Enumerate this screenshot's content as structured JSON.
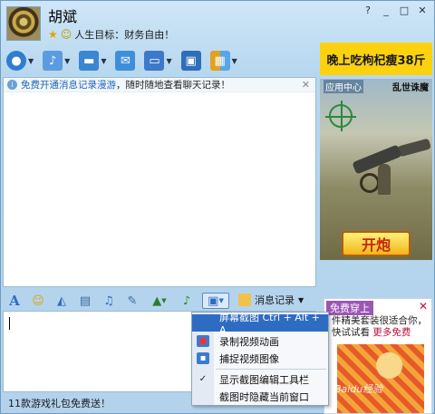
{
  "window": {
    "contact_name": "胡斌",
    "signature": "人生目标：财务自由！",
    "controls": [
      "help-icon",
      "minimize-icon",
      "maximize-icon",
      "close-icon"
    ]
  },
  "toolbar": {
    "buttons": [
      {
        "name": "video-call",
        "icon": "camera-icon",
        "color": "#2e7dd0"
      },
      {
        "name": "voice-call",
        "icon": "microphone-icon",
        "color": "#5c9be0"
      },
      {
        "name": "send-file",
        "icon": "folder-icon",
        "color": "#3a86d0"
      },
      {
        "name": "send-sms",
        "icon": "message-icon",
        "color": "#3f8fd8"
      },
      {
        "name": "remote-assist",
        "icon": "monitor-icon",
        "color": "#3c79c8"
      },
      {
        "name": "share-screen",
        "icon": "screen-icon",
        "color": "#2f6fb8"
      },
      {
        "name": "apps",
        "icon": "apps-grid-icon",
        "color": "#e0a21f"
      }
    ]
  },
  "ads": {
    "top_banner": "晚上吃枸杞瘦38斤",
    "panel_tag": "应用中心",
    "panel_game": "乱世诛魔",
    "panel_button": "开炮",
    "bottom_title": "免费穿上",
    "bottom_text": "件精美套装很适合你，快试试看",
    "bottom_more": "更多免费",
    "watermark": "Baidu经验"
  },
  "info_bar": {
    "link_text": "免费开通消息记录漫游",
    "rest_text": "，随时随地查看聊天记录！"
  },
  "input_toolbar": {
    "icons": [
      "font-icon",
      "emoji-icon",
      "shake-icon",
      "gif-icon",
      "voice-msg-icon",
      "handwriting-icon",
      "image-icon",
      "music-icon",
      "screenshot-icon"
    ],
    "history_label": "消息记录"
  },
  "screenshot_menu": {
    "items": [
      {
        "label": "屏幕截图 Ctrl + Alt + A",
        "selected": true
      },
      {
        "label": "录制视频动画",
        "selected": false
      },
      {
        "label": "捕捉视频图像",
        "selected": false
      },
      {
        "label": "显示截图编辑工具栏",
        "selected": false,
        "checked": true
      },
      {
        "label": "截图时隐藏当前窗口",
        "selected": false
      }
    ]
  },
  "status": {
    "bottom_text": "11款游戏礼包免费送！"
  }
}
